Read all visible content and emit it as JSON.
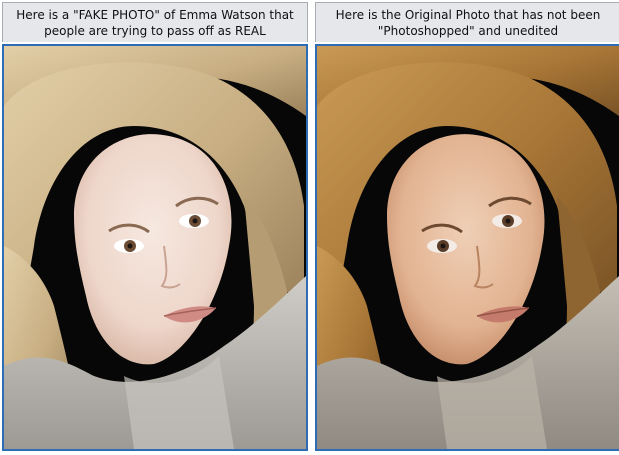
{
  "panels": [
    {
      "caption_line1": "Here is a \"FAKE PHOTO\" of Emma Watson that",
      "caption_line2": "people are trying to pass off as REAL"
    },
    {
      "caption_line1": "Here is the Original Photo that has not been",
      "caption_line2": "\"Photoshopped\" and unedited"
    }
  ],
  "colors": {
    "frame_border": "#2f6cb6",
    "caption_bg": "#e6e7eb",
    "fake_skin": "#f1ddd2",
    "fake_hair": "#cdb48a",
    "original_skin": "#e7bc9e",
    "original_hair": "#a87938",
    "sweater": "#b9b6b0"
  }
}
